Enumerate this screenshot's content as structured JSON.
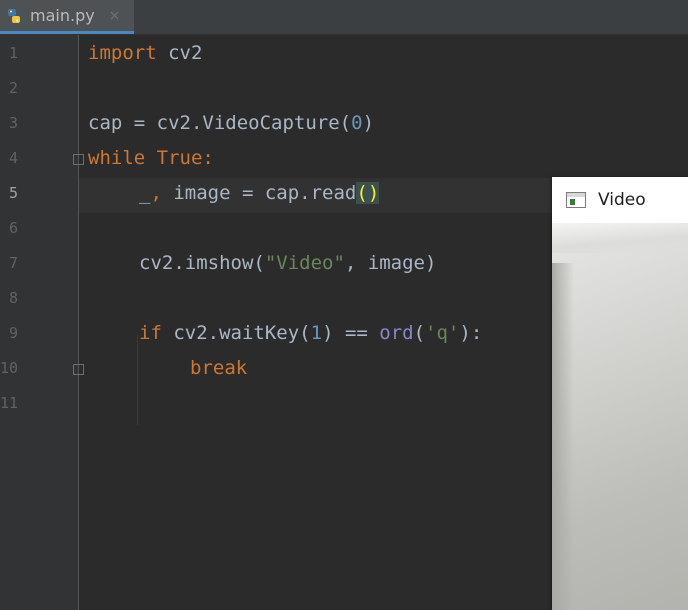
{
  "tab": {
    "filename": "main.py",
    "close_glyph": "×",
    "icon": "python-file-icon"
  },
  "editor": {
    "line_numbers": [
      "1",
      "2",
      "3",
      "4",
      "5",
      "6",
      "7",
      "8",
      "9",
      "10",
      "11"
    ],
    "active_line": 5
  },
  "code": {
    "l1_kw": "import",
    "l1_rest": " cv2",
    "l3": "cap = cv2.VideoCapture(",
    "l3_num": "0",
    "l3_end": ")",
    "l4_kw1": "while",
    "l4_kw2": "True",
    "l4_end": ":",
    "l5_a": "_",
    "l5_b": ", ",
    "l5_c": "image = cap.read",
    "l5_paren": "()",
    "l7_a": "cv2.imshow(",
    "l7_str": "\"Video\"",
    "l7_b": ", image)",
    "l9_kw": "if",
    "l9_a": " cv2.waitKey(",
    "l9_num": "1",
    "l9_b": ") == ",
    "l9_fn": "ord",
    "l9_c": "(",
    "l9_str": "'q'",
    "l9_d": "):",
    "l10_kw": "break"
  },
  "video_window": {
    "title": "Video",
    "icon": "window-icon"
  }
}
